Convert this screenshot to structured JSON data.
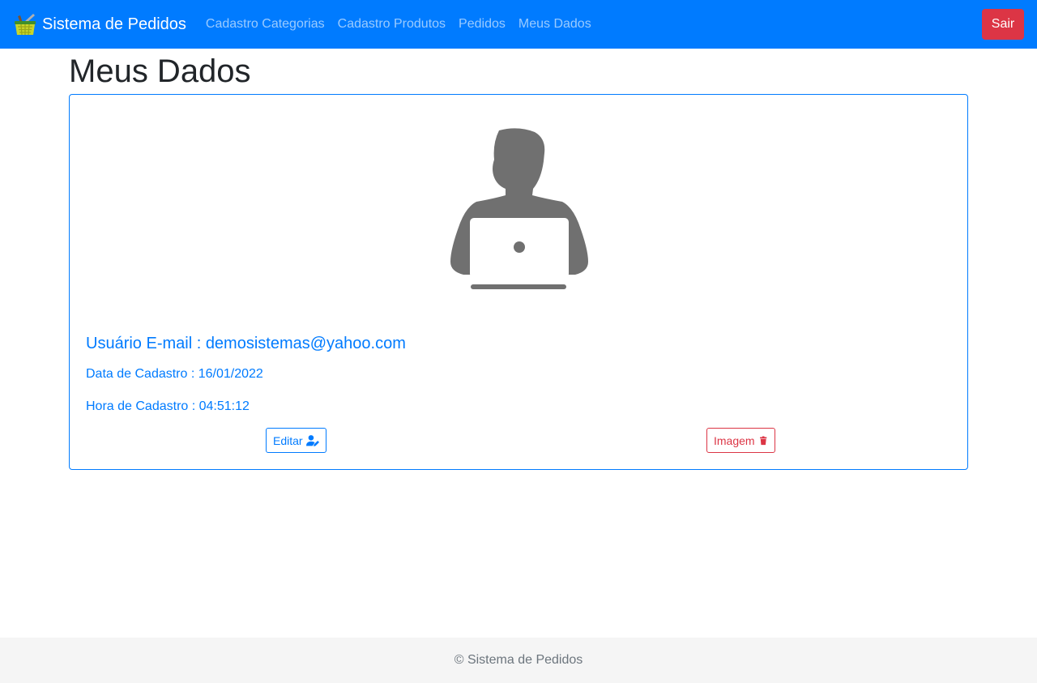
{
  "navbar": {
    "brand": "Sistema de Pedidos",
    "brand_icon": "shopping-basket-icon",
    "links": [
      "Cadastro Categorias",
      "Cadastro Produtos",
      "Pedidos",
      "Meus Dados"
    ],
    "logout_label": "Sair"
  },
  "page": {
    "title": "Meus Dados"
  },
  "profile": {
    "avatar_icon": "user-laptop-icon",
    "email_line": "Usuário E-mail : demosistemas@yahoo.com",
    "date_line": "Data de Cadastro : 16/01/2022",
    "time_line": "Hora de Cadastro : 04:51:12",
    "edit_label": "Editar",
    "edit_icon": "user-edit-icon",
    "image_label": "Imagem",
    "image_icon": "trash-icon"
  },
  "footer": {
    "text": "© Sistema de Pedidos"
  },
  "colors": {
    "primary": "#007bff",
    "danger": "#dc3545",
    "avatar": "#707070",
    "footer_bg": "#f5f5f5"
  }
}
